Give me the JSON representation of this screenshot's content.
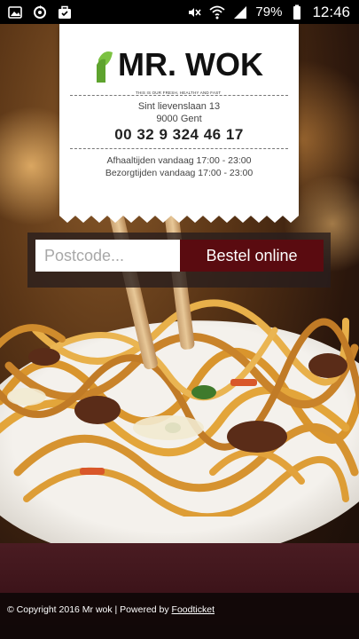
{
  "statusbar": {
    "battery_percent": "79%",
    "time": "12:46",
    "icons_left": [
      "image-icon",
      "sync-icon",
      "briefcase-icon"
    ],
    "icons_right": [
      "mute-icon",
      "wifi-icon",
      "signal-icon",
      "battery-icon"
    ]
  },
  "brand": {
    "name": "MR. WOK",
    "tagline": "THIS IS OUR FRESH, HEALTHY AND FAST"
  },
  "location": {
    "street": "Sint lievenslaan 13",
    "city": "9000 Gent",
    "phone": "00 32 9 324 46 17",
    "pickup_hours": "Afhaaltijden vandaag 17:00 - 23:00",
    "delivery_hours": "Bezorgtijden vandaag 17:00 - 23:00"
  },
  "order": {
    "postcode_placeholder": "Postcode...",
    "postcode_value": "",
    "button_label": "Bestel online"
  },
  "footer": {
    "copyright": "© Copyright 2016 Mr wok | Powered by ",
    "powered_by_link": "Foodticket"
  },
  "colors": {
    "order_button": "#5a0b10",
    "logo_green": "#7cc242"
  }
}
